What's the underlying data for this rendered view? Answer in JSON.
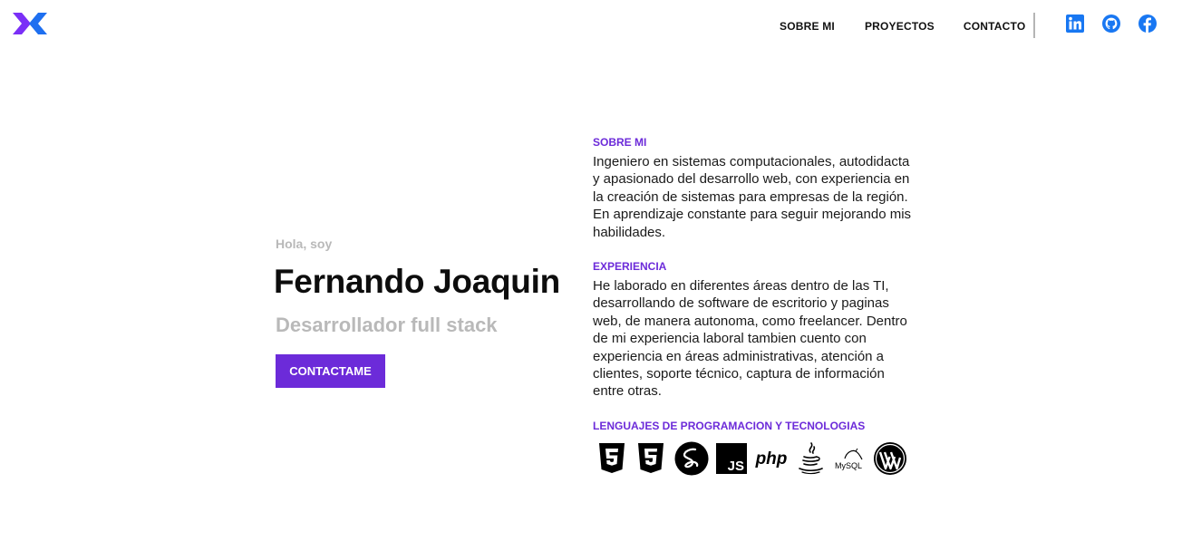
{
  "header": {
    "logo": "logo-icon",
    "nav": [
      {
        "label": "SOBRE MI"
      },
      {
        "label": "PROYECTOS"
      },
      {
        "label": "CONTACTO"
      }
    ],
    "social": [
      "linkedin-icon",
      "github-icon",
      "facebook-icon"
    ]
  },
  "hero": {
    "greeting": "Hola, soy",
    "name": "Fernando Joaquin",
    "role": "Desarrollador full stack",
    "cta_label": "CONTACTAME"
  },
  "about": {
    "title": "SOBRE MI",
    "text": "Ingeniero en sistemas computacionales, autodidacta y apasionado del desarrollo web, con experiencia en la creación de sistemas para empresas de la región. En aprendizaje constante para seguir mejorando mis habilidades."
  },
  "experience": {
    "title": "EXPERIENCIA",
    "text": "He laborado en diferentes áreas dentro de las TI, desarrollando de software de escritorio y paginas web, de manera autonoma, como freelancer. Dentro de mi experiencia laboral tambien cuento con experiencia en áreas administrativas, atención a clientes, soporte técnico, captura de información entre otras."
  },
  "technologies": {
    "title": "LENGUAJES DE PROGRAMACION Y TECNOLOGIAS",
    "icons": [
      "html5-icon",
      "css3-icon",
      "sass-icon",
      "javascript-icon",
      "php-icon",
      "java-icon",
      "mysql-icon",
      "wordpress-icon"
    ],
    "php_text": "php",
    "js_text": "JS",
    "mysql_text": "MySQL"
  },
  "colors": {
    "accent": "#6c2bd9",
    "social_blue": "#1877f2",
    "muted_text": "#b9b9b9",
    "logo_purple": "#7b2ff7",
    "logo_blue": "#1e6ff0"
  }
}
